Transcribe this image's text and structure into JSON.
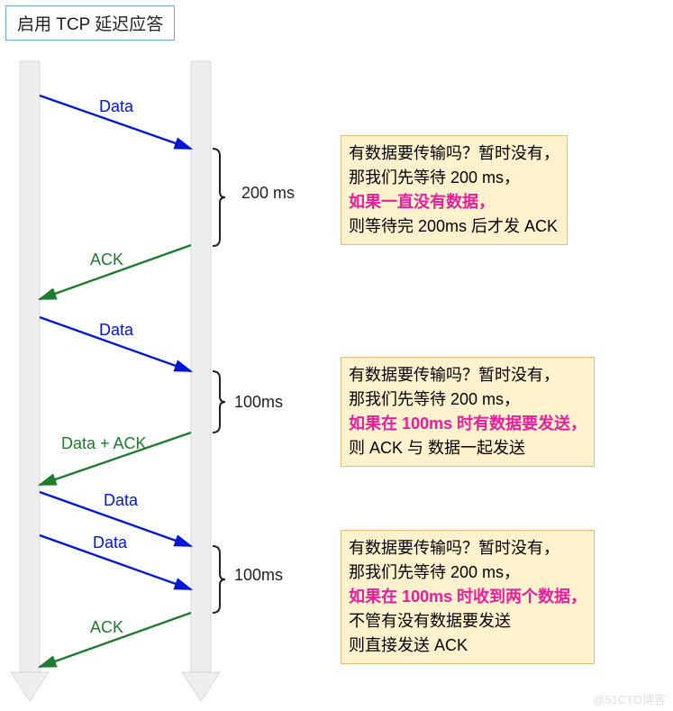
{
  "title": "启用 TCP 延迟应答",
  "labels": {
    "data1": "Data",
    "ack1": "ACK",
    "data2": "Data",
    "dataack": "Data + ACK",
    "data3": "Data",
    "data4": "Data",
    "ack2": "ACK",
    "t1": "200 ms",
    "t2": "100ms",
    "t3": "100ms"
  },
  "box1": {
    "l1": "有数据要传输吗？暂时没有，",
    "l2": "那我们先等待 200 ms，",
    "l3": "如果一直没有数据，",
    "l4": "则等待完 200ms 后才发 ACK"
  },
  "box2": {
    "l1": "有数据要传输吗？暂时没有，",
    "l2": "那我们先等待 200 ms，",
    "l3": "如果在 100ms 时有数据要发送，",
    "l4": "则 ACK 与 数据一起发送"
  },
  "box3": {
    "l1": "有数据要传输吗？暂时没有，",
    "l2": "那我们先等待 200 ms，",
    "l3": "如果在 100ms 时收到两个数据，",
    "l4": "不管有没有数据要发送",
    "l5": "则直接发送 ACK"
  },
  "watermark": "@51CTO博客"
}
